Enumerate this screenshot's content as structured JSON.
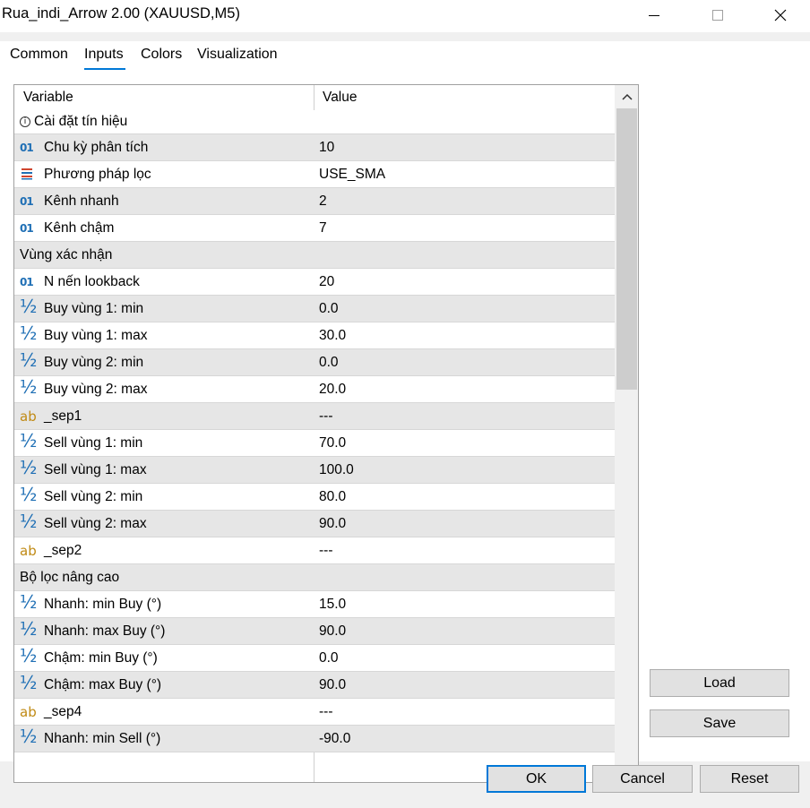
{
  "window": {
    "title": "Rua_indi_Arrow 2.00 (XAUUSD,M5)"
  },
  "tabs": [
    {
      "label": "Common"
    },
    {
      "label": "Inputs"
    },
    {
      "label": "Colors"
    },
    {
      "label": "Visualization"
    }
  ],
  "active_tab": "Inputs",
  "grid": {
    "header_variable": "Variable",
    "header_value": "Value",
    "rows": [
      {
        "type": "group-info",
        "name": "Cài đặt tín hiệu",
        "value": ""
      },
      {
        "type": "int",
        "icon": "integer-icon",
        "name": "Chu kỳ phân tích",
        "value": "10"
      },
      {
        "type": "enum",
        "icon": "enum-list-icon",
        "name": "Phương pháp lọc",
        "value": "USE_SMA"
      },
      {
        "type": "int",
        "icon": "integer-icon",
        "name": "Kênh nhanh",
        "value": "2"
      },
      {
        "type": "int",
        "icon": "integer-icon",
        "name": "Kênh chậm",
        "value": "7"
      },
      {
        "type": "group",
        "name": "Vùng xác nhận",
        "value": ""
      },
      {
        "type": "int",
        "icon": "integer-icon",
        "name": "N nến lookback",
        "value": "20"
      },
      {
        "type": "double",
        "icon": "double-icon",
        "name": "Buy vùng 1: min",
        "value": "0.0"
      },
      {
        "type": "double",
        "icon": "double-icon",
        "name": "Buy vùng 1: max",
        "value": "30.0"
      },
      {
        "type": "double",
        "icon": "double-icon",
        "name": "Buy vùng 2: min",
        "value": "0.0"
      },
      {
        "type": "double",
        "icon": "double-icon",
        "name": "Buy vùng 2: max",
        "value": "20.0"
      },
      {
        "type": "string",
        "icon": "string-icon",
        "name": "_sep1",
        "value": "---"
      },
      {
        "type": "double",
        "icon": "double-icon",
        "name": "Sell vùng 1: min",
        "value": "70.0"
      },
      {
        "type": "double",
        "icon": "double-icon",
        "name": "Sell vùng 1: max",
        "value": "100.0"
      },
      {
        "type": "double",
        "icon": "double-icon",
        "name": "Sell vùng 2: min",
        "value": "80.0"
      },
      {
        "type": "double",
        "icon": "double-icon",
        "name": "Sell vùng 2: max",
        "value": "90.0"
      },
      {
        "type": "string",
        "icon": "string-icon",
        "name": "_sep2",
        "value": "---"
      },
      {
        "type": "group",
        "name": "Bộ lọc nâng cao",
        "value": ""
      },
      {
        "type": "double",
        "icon": "double-icon",
        "name": "Nhanh: min Buy (°)",
        "value": "15.0"
      },
      {
        "type": "double",
        "icon": "double-icon",
        "name": "Nhanh: max Buy (°)",
        "value": "90.0"
      },
      {
        "type": "double",
        "icon": "double-icon",
        "name": "Chậm: min Buy (°)",
        "value": "0.0"
      },
      {
        "type": "double",
        "icon": "double-icon",
        "name": "Chậm: max Buy (°)",
        "value": "90.0"
      },
      {
        "type": "string",
        "icon": "string-icon",
        "name": "_sep4",
        "value": "---"
      },
      {
        "type": "double",
        "icon": "double-icon",
        "name": "Nhanh: min Sell (°)",
        "value": "-90.0"
      }
    ]
  },
  "side_buttons": {
    "load": "Load",
    "save": "Save"
  },
  "footer_buttons": {
    "ok": "OK",
    "cancel": "Cancel",
    "reset": "Reset"
  },
  "colors": {
    "accent": "#0078d7",
    "int_icon": "#1f6fb5",
    "string_icon": "#c08a14",
    "row_alt": "#e6e6e6"
  }
}
